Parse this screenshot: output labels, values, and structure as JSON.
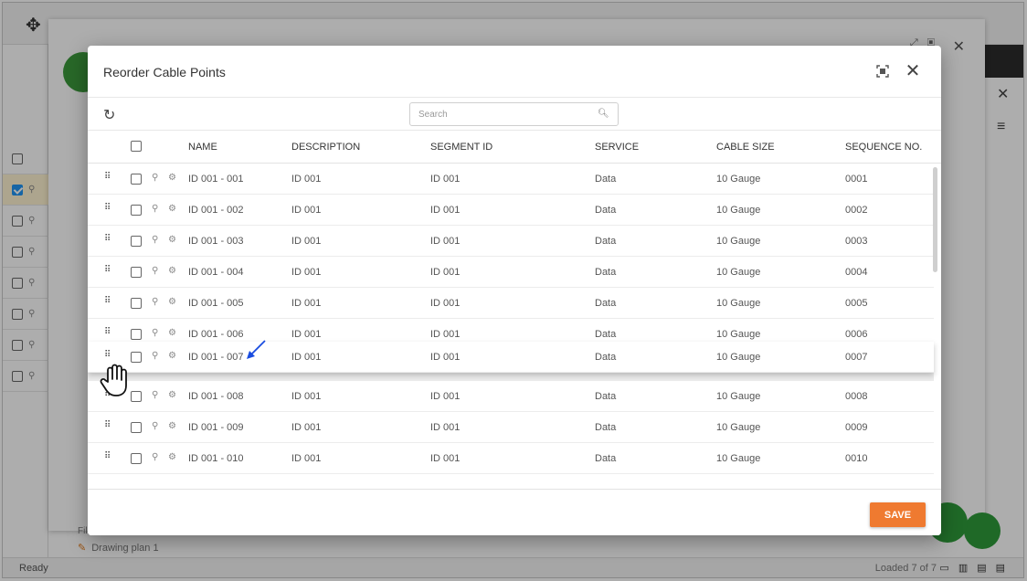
{
  "background": {
    "status": "Ready",
    "loaded": "Loaded 7 of 7",
    "drawing_plan": "Drawing plan 1",
    "filter_label": "Fil"
  },
  "dialog": {
    "title": "Reorder Cable Points",
    "search_placeholder": "Search",
    "save_label": "SAVE"
  },
  "columns": {
    "name": "NAME",
    "description": "DESCRIPTION",
    "segment_id": "SEGMENT ID",
    "service": "SERVICE",
    "cable_size": "CABLE SIZE",
    "sequence_no": "SEQUENCE NO."
  },
  "rows": [
    {
      "name": "ID 001 - 001",
      "description": "ID 001",
      "segment_id": "ID 001",
      "service": "Data",
      "cable_size": "10 Gauge",
      "sequence_no": "0001"
    },
    {
      "name": "ID 001 - 002",
      "description": "ID 001",
      "segment_id": "ID 001",
      "service": "Data",
      "cable_size": "10 Gauge",
      "sequence_no": "0002"
    },
    {
      "name": "ID 001 - 003",
      "description": "ID 001",
      "segment_id": "ID 001",
      "service": "Data",
      "cable_size": "10 Gauge",
      "sequence_no": "0003"
    },
    {
      "name": "ID 001 - 004",
      "description": "ID 001",
      "segment_id": "ID 001",
      "service": "Data",
      "cable_size": "10 Gauge",
      "sequence_no": "0004"
    },
    {
      "name": "ID 001 - 005",
      "description": "ID 001",
      "segment_id": "ID 001",
      "service": "Data",
      "cable_size": "10 Gauge",
      "sequence_no": "0005"
    },
    {
      "name": "ID 001 - 006",
      "description": "ID 001",
      "segment_id": "ID 001",
      "service": "Data",
      "cable_size": "10 Gauge",
      "sequence_no": "0006"
    },
    {
      "name": "ID 001 - 007",
      "description": "ID 001",
      "segment_id": "ID 001",
      "service": "Data",
      "cable_size": "10 Gauge",
      "sequence_no": "0007"
    },
    {
      "name": "ID 001 - 008",
      "description": "ID 001",
      "segment_id": "ID 001",
      "service": "Data",
      "cable_size": "10 Gauge",
      "sequence_no": "0008"
    },
    {
      "name": "ID 001 - 009",
      "description": "ID 001",
      "segment_id": "ID 001",
      "service": "Data",
      "cable_size": "10 Gauge",
      "sequence_no": "0009"
    },
    {
      "name": "ID 001 - 010",
      "description": "ID 001",
      "segment_id": "ID 001",
      "service": "Data",
      "cable_size": "10 Gauge",
      "sequence_no": "0010"
    }
  ],
  "icons": {
    "drag_handle": "drag-handle-icon",
    "location": "location-pin-icon",
    "settings": "gear-icon",
    "refresh": "refresh-icon",
    "search": "search-icon",
    "close": "close-icon",
    "maximize": "maximize-icon"
  },
  "colors": {
    "save": "#ef7a30",
    "selected_row_bg": "#fff4d1",
    "checked": "#2196f3",
    "brand_green": "#3c9a3c"
  }
}
